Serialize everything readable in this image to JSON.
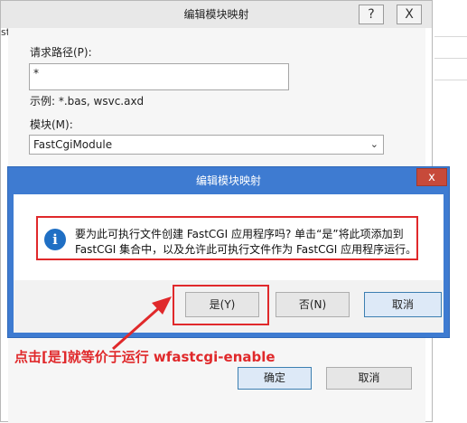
{
  "background": {
    "left_text": "st"
  },
  "outer_dialog": {
    "title": "编辑模块映射",
    "help_button": "?",
    "close_button": "X",
    "request_path_label": "请求路径(P):",
    "request_path_value": "*",
    "example_text": "示例: *.bas, wsvc.axd",
    "module_label": "模块(M):",
    "module_value": "FastCgiModule",
    "ok_button": "确定",
    "cancel_button": "取消"
  },
  "confirm_dialog": {
    "title": "编辑模块映射",
    "close_button": "x",
    "message_line1": "要为此可执行文件创建 FastCGI 应用程序吗? 单击“是”将此项添加到",
    "message_line2": "FastCGI 集合中，以及允许此可执行文件作为 FastCGI 应用程序运行。",
    "yes_button": "是(Y)",
    "no_button": "否(N)",
    "cancel_button": "取消"
  },
  "annotation": {
    "text": "点击[是]就等价于运行 wfastcgi-enable"
  },
  "colors": {
    "accent_red": "#e0292b",
    "title_blue": "#3e7bd1"
  }
}
